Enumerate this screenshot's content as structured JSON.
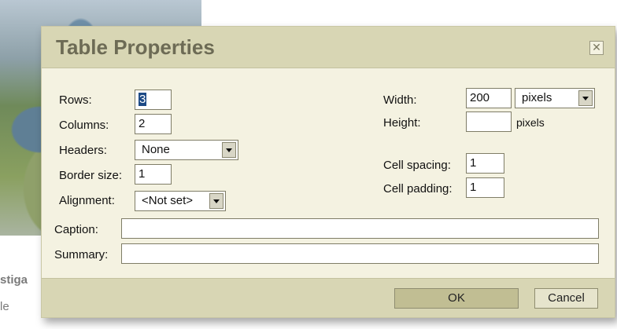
{
  "background": {
    "line1": "stiga",
    "line2": "le"
  },
  "dialog": {
    "title": "Table Properties",
    "close_icon": "close-icon",
    "rows_label": "Rows:",
    "rows_value": "3",
    "columns_label": "Columns:",
    "columns_value": "2",
    "headers_label": "Headers:",
    "headers_value": "None",
    "border_label": "Border size:",
    "border_value": "1",
    "alignment_label": "Alignment:",
    "alignment_value": "<Not set>",
    "width_label": "Width:",
    "width_value": "200",
    "width_unit": "pixels",
    "height_label": "Height:",
    "height_value": "",
    "height_unit": "pixels",
    "cellspacing_label": "Cell spacing:",
    "cellspacing_value": "1",
    "cellpadding_label": "Cell padding:",
    "cellpadding_value": "1",
    "caption_label": "Caption:",
    "caption_value": "",
    "summary_label": "Summary:",
    "summary_value": "",
    "ok_label": "OK",
    "cancel_label": "Cancel"
  },
  "colors": {
    "dialog_bg": "#f4f2e1",
    "titlebar_bg": "#d8d6b4",
    "title_text": "#6d6b55",
    "ok_button": "#c1be93"
  }
}
